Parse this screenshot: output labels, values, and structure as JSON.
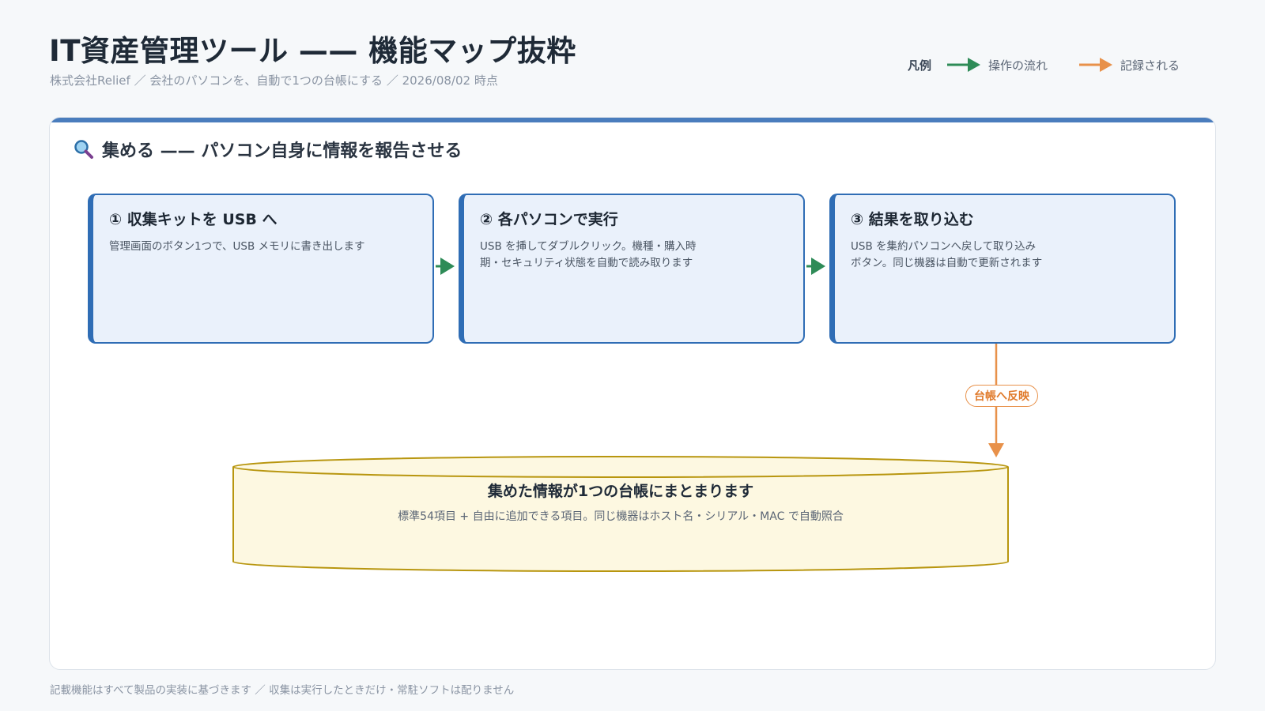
{
  "header": {
    "title": "IT資産管理ツール —— 機能マップ抜粋",
    "subtitle": "株式会社Relief ／ 会社のパソコンを、自動で1つの台帳にする ／ 2026/08/02 時点"
  },
  "legend": {
    "title": "凡例",
    "items": [
      {
        "label": "操作の流れ",
        "color": "#2e8b57",
        "icon": "arrow-icon"
      },
      {
        "label": "記録される",
        "color": "#e8914a",
        "icon": "arrow-icon"
      }
    ]
  },
  "panel": {
    "icon": "magnifier-icon",
    "heading": "集める —— パソコン自身に情報を報告させる",
    "accent_color": "#4a7dbd",
    "steps": [
      {
        "title": "① 収集キットを USB へ",
        "desc": "管理画面のボタン1つで、USB メモリに書き出します"
      },
      {
        "title": "② 各パソコンで実行",
        "desc": "USB を挿してダブルクリック。機種・購入時期・セキュリティ状態を自動で読み取ります"
      },
      {
        "title": "③ 結果を取り込む",
        "desc": "USB を集約パソコンへ戻して取り込みボタン。同じ機器は自動で更新されます"
      }
    ],
    "record_label": "台帳へ反映",
    "ledger": {
      "title": "集めた情報が1つの台帳にまとまります",
      "desc": "標準54項目 + 自由に追加できる項目。同じ機器はホスト名・シリアル・MAC で自動照合",
      "color": "#fdf8e1"
    }
  },
  "footer": "記載機能はすべて製品の実装に基づきます ／ 収集は実行したときだけ・常駐ソフトは配りません"
}
